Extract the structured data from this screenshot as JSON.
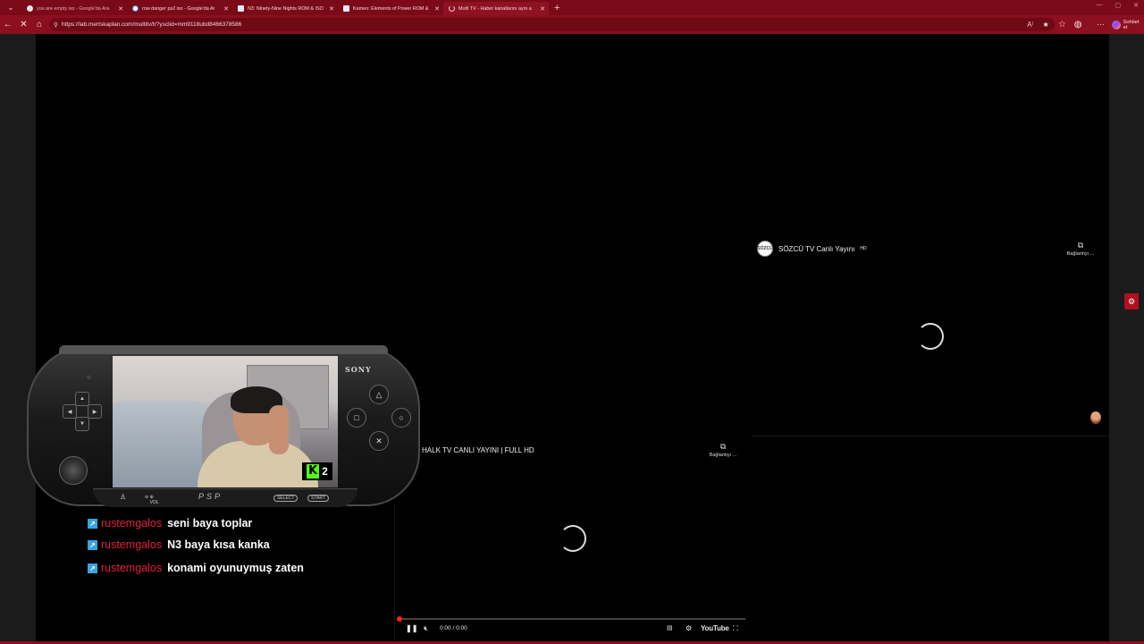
{
  "browser": {
    "tabs": [
      {
        "title": "you are empty iso - Google'da Ara",
        "state": "muted"
      },
      {
        "title": "row danger ps2 iso - Google'da Ar",
        "state": "normal"
      },
      {
        "title": "N3: Ninety-Nine Nights ROM & ISO",
        "state": "normal"
      },
      {
        "title": "Kameo: Elements of Power ROM &",
        "state": "normal"
      },
      {
        "title": "Multi TV - Haber kanallarını aynı a",
        "state": "active"
      }
    ],
    "new_tab": "+",
    "url": "https://lab.mertskaplan.com/multitv/tr?ysclid=mm9118ubd8466378586",
    "copilot_label": "Sohbet et",
    "accent": "#8c0f1f"
  },
  "players": {
    "sozcu": {
      "logo_text": "SÖZCÜ",
      "title": "SÖZCÜ TV Canlı Yayını",
      "title_suffix": "HD",
      "copy_label": "Bağlantıyı ..."
    },
    "halk": {
      "title": "HALK TV CANLI YAYINI | FULL HD",
      "copy_label": "Bağlantıyı ...",
      "time": "0:00 / 0:00",
      "yt_brand": "YouTube"
    }
  },
  "psp": {
    "brand": "SONY",
    "logo": "PSP",
    "vol_label": "VOL",
    "select_label": "SELECT",
    "start_label": "START",
    "kick_count": "2"
  },
  "chat": [
    {
      "user": "rustemgalos",
      "message": "seni baya toplar"
    },
    {
      "user": "rustemgalos",
      "message": "N3 baya kısa kanka"
    },
    {
      "user": "rustemgalos",
      "message": "konami oyunuymuş zaten"
    }
  ],
  "colors": {
    "chat_user": "#e61e3c",
    "kick_green": "#53fc18",
    "yt_red": "#ff1f1f"
  }
}
